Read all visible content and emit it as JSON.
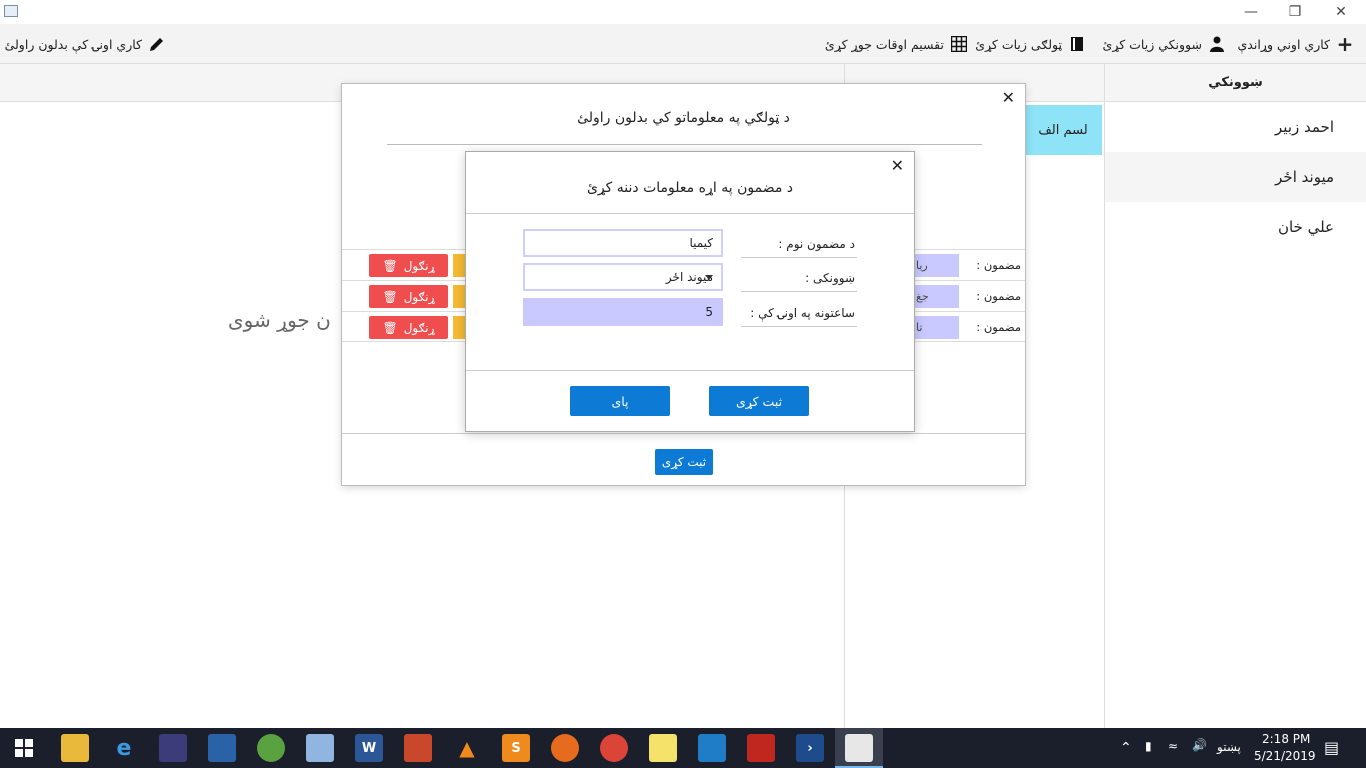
{
  "toolbar": {
    "add_work_day": "كاري اوني وړاندې",
    "add_teacher": "ښوونكي زيات كړئ",
    "add_class": "ټولګی زيات كړئ",
    "create_schedule": "تقسيم اوقات جوړ كړئ",
    "change_work_days": "كاري اونۍ كې بدلون راولئ"
  },
  "left_column": {
    "placeholder": "ن جوړ شوی"
  },
  "middle_column": {
    "class_chip": "لسم الف"
  },
  "right_column": {
    "header": "ښوونكي",
    "teachers": [
      {
        "name": "احمد زبير"
      },
      {
        "name": "ميوند اځر"
      },
      {
        "name": "علي خان"
      }
    ]
  },
  "outer_dialog": {
    "title": "د ټولګي په معلوماتو کي بدلون راولئ",
    "subject_label": "مضمون :",
    "delete_label": "ړنګول",
    "rows": [
      {
        "subject": "ريا"
      },
      {
        "subject": "جغ"
      },
      {
        "subject": "تا"
      }
    ],
    "save_label": "ثبت کړی"
  },
  "inner_dialog": {
    "title": "د مضمون په اړه معلومات دننه کړئ",
    "subject_name_label": "د مضمون نوم :",
    "subject_name_value": "کيميا",
    "teacher_label": "ښوونکی :",
    "teacher_value": "ميوند اځر",
    "hours_label": "ساعتونه په اونۍ کې :",
    "hours_value": "5",
    "submit_label": "ثبت کړی",
    "close_label": "پای"
  },
  "taskbar": {
    "time": "2:18 PM",
    "date": "5/21/2019",
    "language": "پښتو"
  },
  "colors": {
    "primary_button": "#0d7bd6",
    "delete_button": "#f04e4e",
    "edit_button": "#f5b932",
    "input_highlight": "#c9c9ff",
    "class_chip": "#8fe3f7"
  }
}
